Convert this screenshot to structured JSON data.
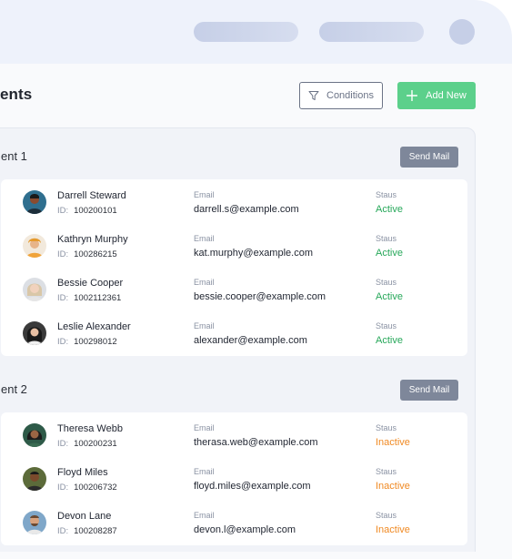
{
  "header": {
    "title": "ents"
  },
  "toolbar": {
    "conditions_label": "Conditions",
    "add_new_label": "Add New"
  },
  "colors": {
    "accent_green": "#5cd08b",
    "active": "#27a85a",
    "inactive": "#f08a24",
    "send_mail_bg": "#7e879a"
  },
  "groups": [
    {
      "title": "ent 1",
      "send_mail_label": "Send Mail",
      "rows": [
        {
          "name": "Darrell Steward",
          "id_label": "ID:",
          "id": "100200101",
          "email_label": "Email",
          "email": "darrell.s@example.com",
          "status_label": "Staus",
          "status": "Active"
        },
        {
          "name": "Kathryn Murphy",
          "id_label": "ID:",
          "id": "100286215",
          "email_label": "Email",
          "email": "kat.murphy@example.com",
          "status_label": "Staus",
          "status": "Active"
        },
        {
          "name": "Bessie Cooper",
          "id_label": "ID:",
          "id": "1002112361",
          "email_label": "Email",
          "email": "bessie.cooper@example.com",
          "status_label": "Staus",
          "status": "Active"
        },
        {
          "name": "Leslie Alexander",
          "id_label": "ID:",
          "id": "100298012",
          "email_label": "Email",
          "email": "alexander@example.com",
          "status_label": "Staus",
          "status": "Active"
        }
      ]
    },
    {
      "title": "ent 2",
      "send_mail_label": "Send Mail",
      "rows": [
        {
          "name": "Theresa Webb",
          "id_label": "ID:",
          "id": "100200231",
          "email_label": "Email",
          "email": "therasa.web@example.com",
          "status_label": "Staus",
          "status": "Inactive"
        },
        {
          "name": "Floyd Miles",
          "id_label": "ID:",
          "id": "100206732",
          "email_label": "Email",
          "email": "floyd.miles@example.com",
          "status_label": "Staus",
          "status": "Inactive"
        },
        {
          "name": "Devon Lane",
          "id_label": "ID:",
          "id": "100208287",
          "email_label": "Email",
          "email": "devon.l@example.com",
          "status_label": "Staus",
          "status": "Inactive"
        }
      ]
    }
  ]
}
